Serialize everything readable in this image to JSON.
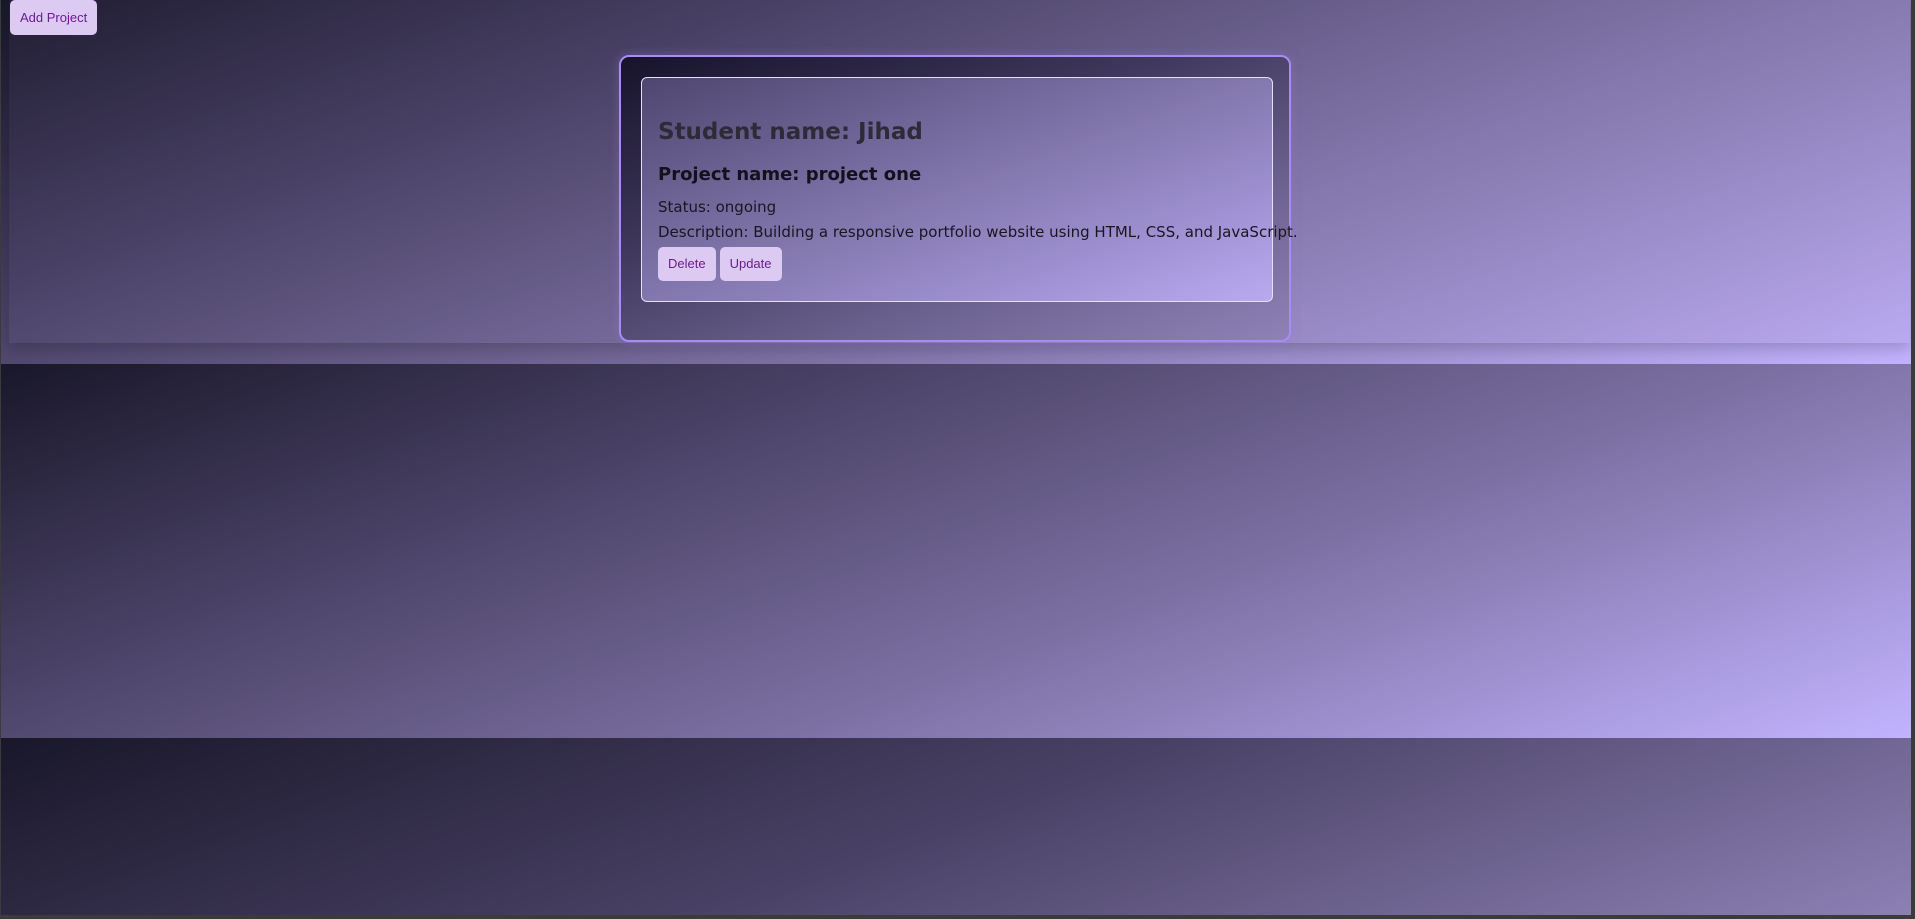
{
  "toolbar": {
    "add_project_label": "Add Project"
  },
  "project_card": {
    "student_name": "Student name: Jihad",
    "project_name": "Project name: project one",
    "status": "Status: ongoing",
    "description": "Description: Building a responsive portfolio website using HTML, CSS, and JavaScript.",
    "delete_label": "Delete",
    "update_label": "Update"
  },
  "colors": {
    "button_background": "#dccaf3",
    "button_text": "#6b1d8f",
    "card_border": "#a98bf2",
    "gradient_dark": "#19172a",
    "gradient_light": "#c2b3ff"
  }
}
